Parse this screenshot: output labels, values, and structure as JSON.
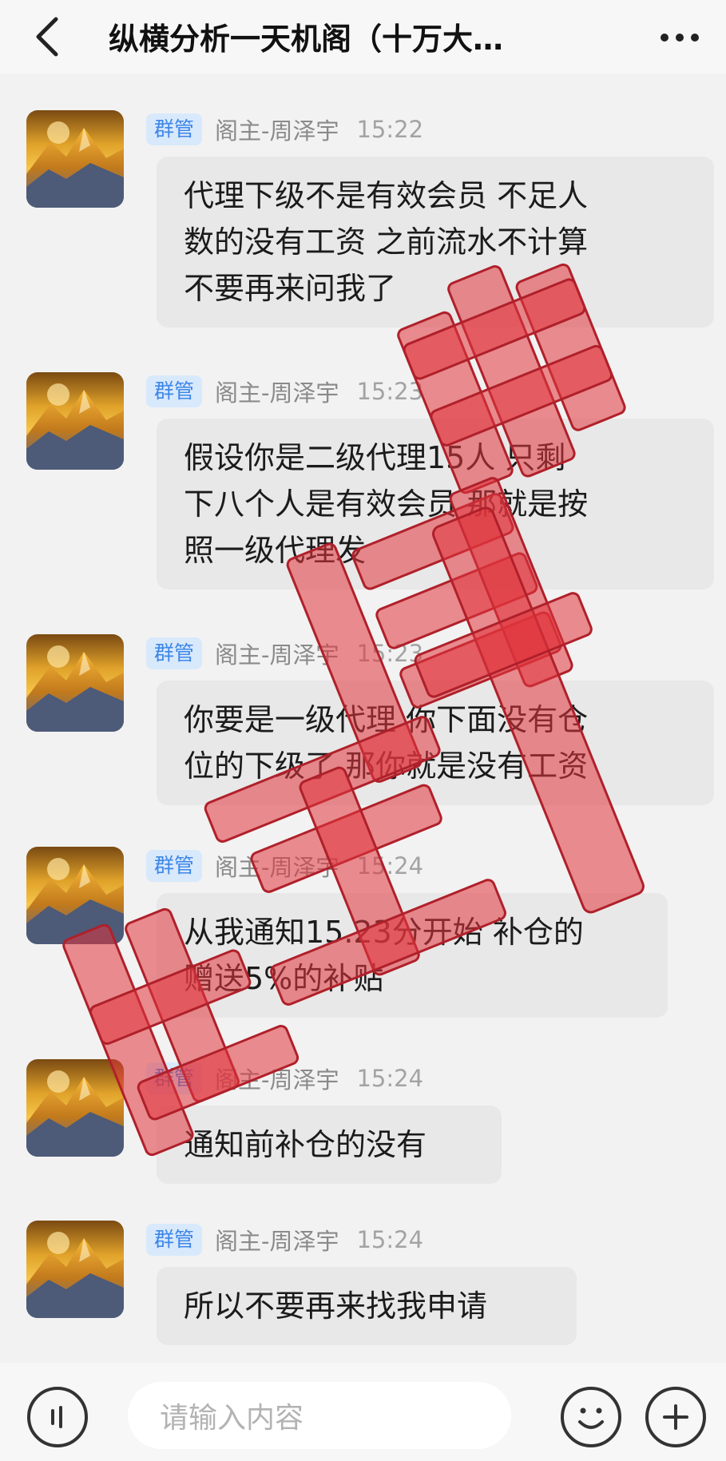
{
  "header": {
    "title": "纵横分析一天机阁（十万大…",
    "back_icon": "back-arrow-icon",
    "more_icon": "more-dots-icon"
  },
  "messages": [
    {
      "badge": "群管",
      "sender": "阁主-周泽宇",
      "time": "15:22",
      "lines": [
        "代理下级不是有效会员 不足人",
        "数的没有工资 之前流水不计算",
        "不要再来问我了"
      ]
    },
    {
      "badge": "群管",
      "sender": "阁主-周泽宇",
      "time": "15:23",
      "lines": [
        "假设你是二级代理15人  只剩",
        "下八个人是有效会员 那就是按",
        "照一级代理发"
      ]
    },
    {
      "badge": "群管",
      "sender": "阁主-周泽宇",
      "time": "15:23",
      "lines": [
        "你要是一级代理 你下面没有仓",
        "位的下级了 那你就是没有工资"
      ]
    },
    {
      "badge": "群管",
      "sender": "阁主-周泽宇",
      "time": "15:24",
      "lines": [
        "从我通知15.23分开始 补仓的",
        "赠送5%的补贴"
      ]
    },
    {
      "badge": "群管",
      "sender": "阁主-周泽宇",
      "time": "15:24",
      "lines": [
        "通知前补仓的没有"
      ]
    },
    {
      "badge": "群管",
      "sender": "阁主-周泽宇",
      "time": "15:24",
      "lines": [
        "所以不要再来找我申请"
      ]
    }
  ],
  "watermark": {
    "text": "骗局 赃票 米路",
    "color": "#e0343c"
  },
  "input": {
    "placeholder": "请输入内容"
  },
  "colors": {
    "badge_bg": "#d8e9fc",
    "badge_text": "#3d86e8",
    "bubble_bg": "#e8e8e8",
    "page_bg": "#f2f2f2"
  }
}
